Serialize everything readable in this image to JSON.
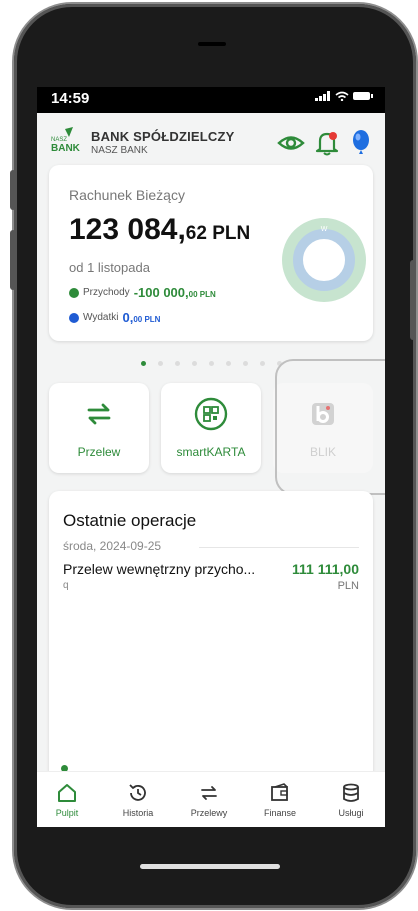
{
  "status": {
    "time": "14:59"
  },
  "bank": {
    "name": "BANK SPÓŁDZIELCZY",
    "subtitle": "NASZ BANK",
    "logo_top": "NASZ",
    "logo_bottom": "BANK"
  },
  "account": {
    "name": "Rachunek Bieżący",
    "balance_int": "123 084,",
    "balance_dec": "62 PLN",
    "since": "od 1 listopada",
    "income_label": "Przychody",
    "income_value": "-100 000,",
    "income_dec": "00 PLN",
    "expense_label": "Wydatki",
    "expense_value": "0,",
    "expense_dec": "00 PLN",
    "donut_letter": "W"
  },
  "pager": {
    "count": 9,
    "active": 0
  },
  "tiles": [
    {
      "label": "Przelew",
      "icon": "transfer-icon"
    },
    {
      "label": "smartKARTA",
      "icon": "qr-card-icon"
    },
    {
      "label": "BLIK",
      "icon": "blik-icon"
    }
  ],
  "operations": {
    "title": "Ostatnie operacje",
    "date": "środa, 2024-09-25",
    "items": [
      {
        "name": "Przelew wewnętrzny przycho...",
        "sub": "q",
        "amount": "111 111,00",
        "currency": "PLN"
      }
    ]
  },
  "nav": [
    {
      "label": "Pulpit",
      "icon": "home-icon"
    },
    {
      "label": "Historia",
      "icon": "history-icon"
    },
    {
      "label": "Przelewy",
      "icon": "transfer-icon"
    },
    {
      "label": "Finanse",
      "icon": "wallet-icon"
    },
    {
      "label": "Usługi",
      "icon": "database-icon"
    }
  ],
  "colors": {
    "accent": "#2e8b3a",
    "blue": "#1f5bd3",
    "donut_outer": "#b6cfe6",
    "donut_ring": "#c7e4cf"
  }
}
